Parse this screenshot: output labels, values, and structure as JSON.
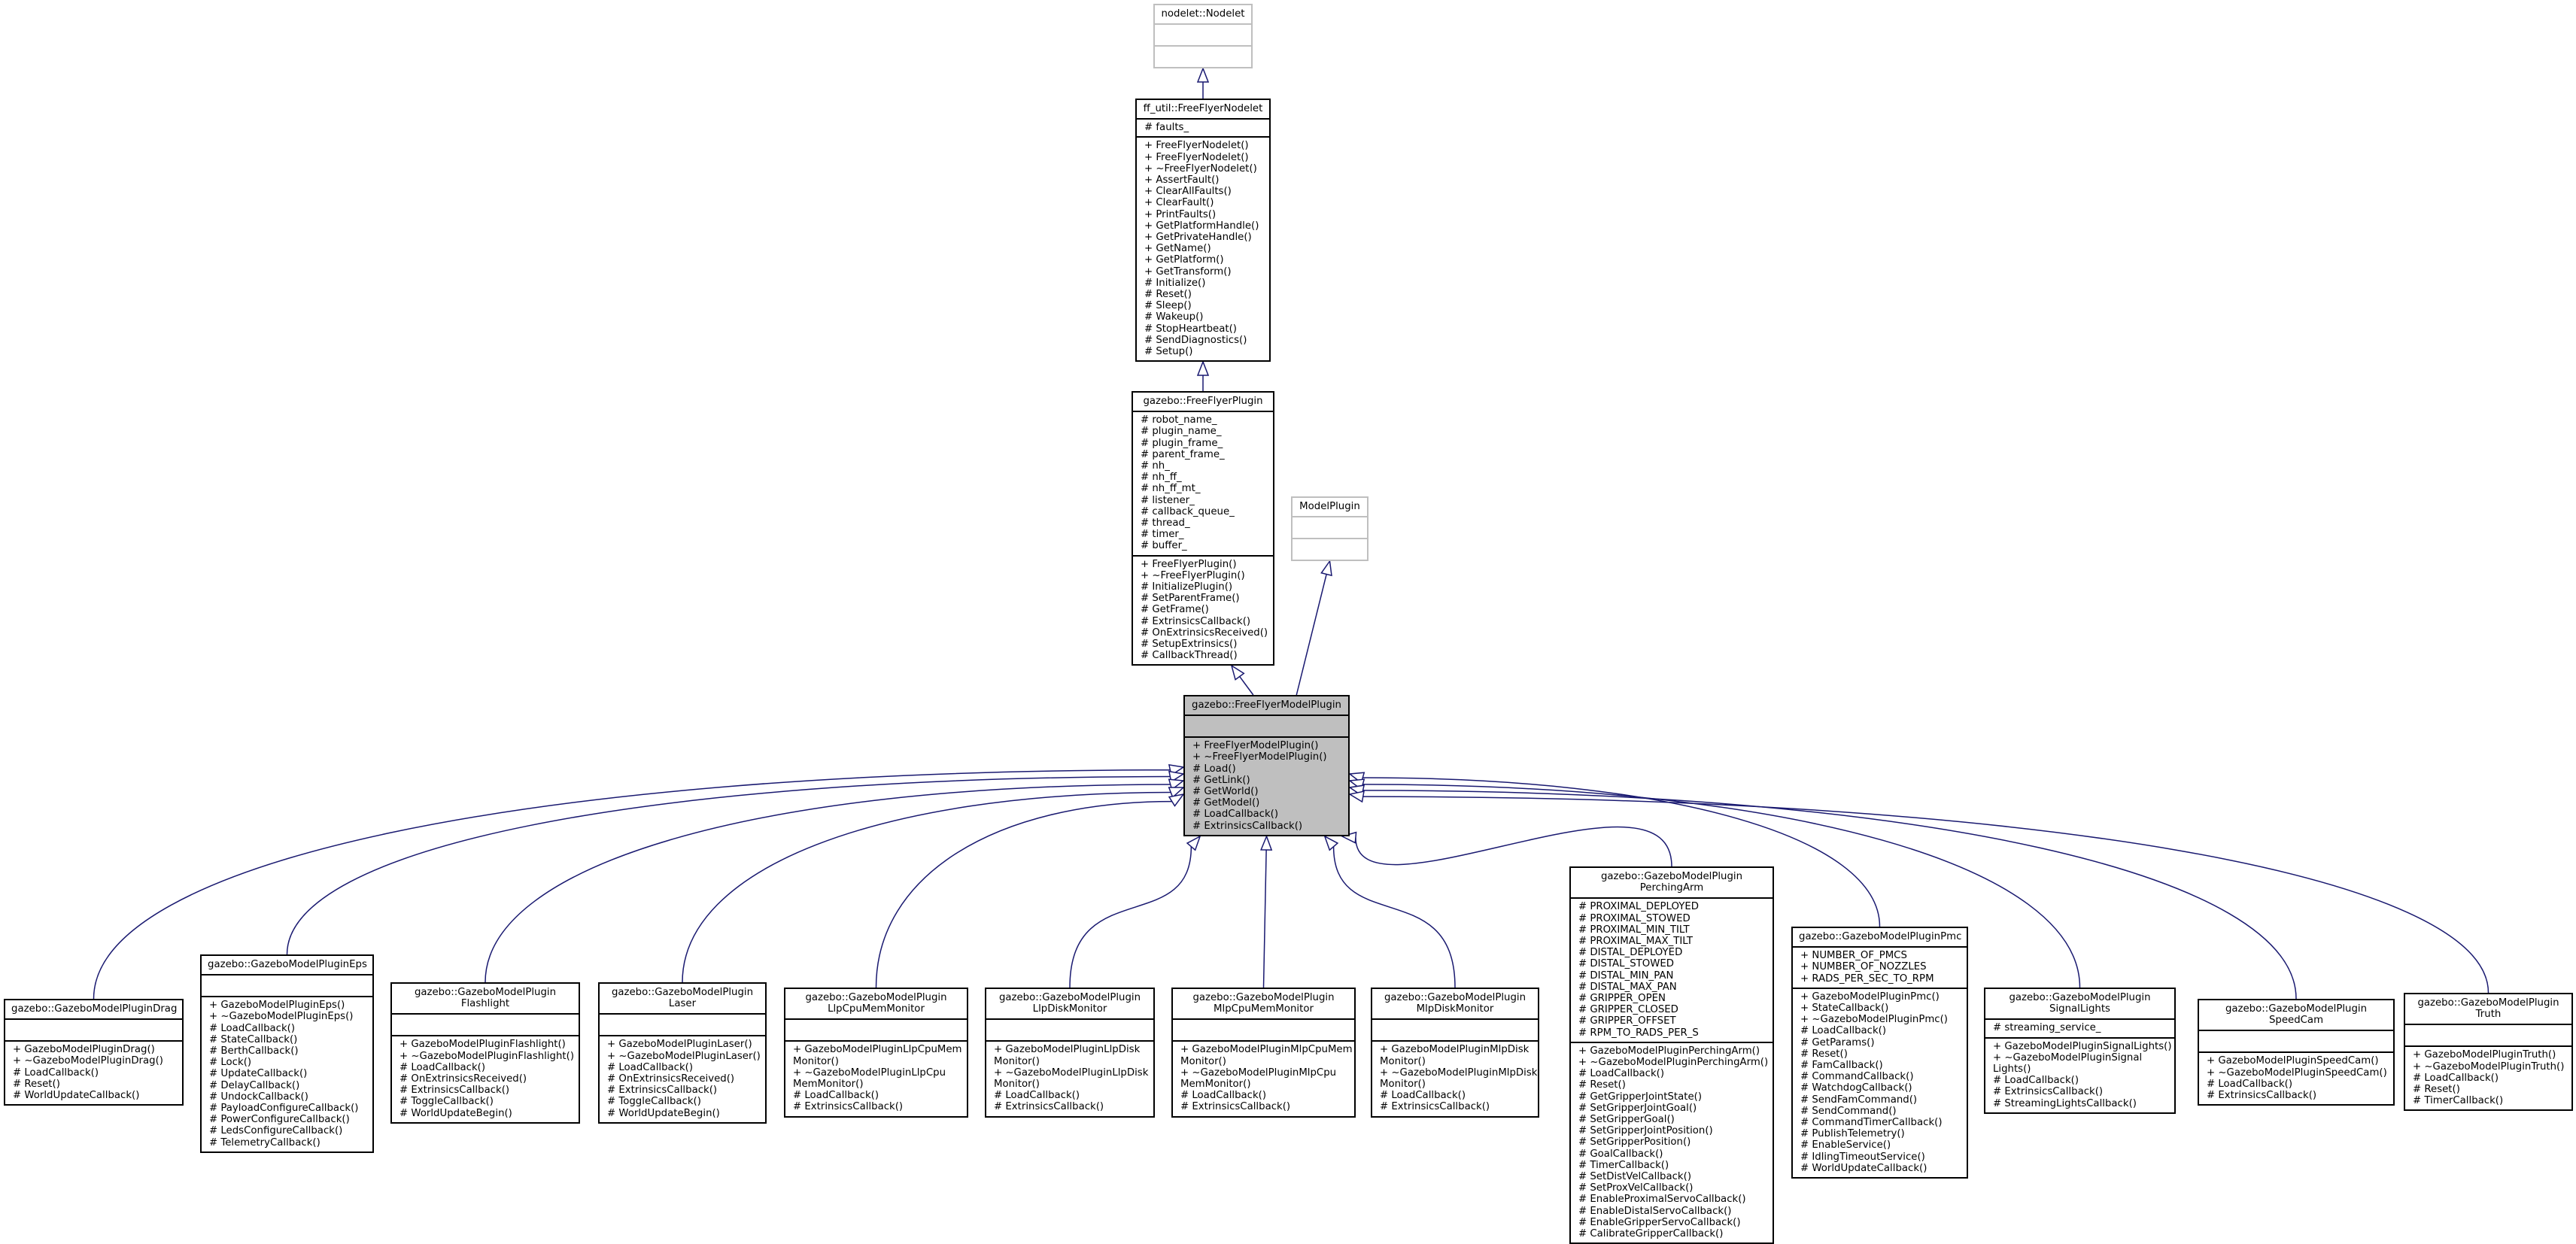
{
  "diagram": {
    "type": "inheritance-graph",
    "edge_color": "#191970",
    "focus_fill": "#bfbfbf",
    "classes": [
      {
        "id": "nodelet",
        "name": "nodelet::Nodelet",
        "external": true,
        "attributes": [],
        "methods": []
      },
      {
        "id": "ffnodelet",
        "name": "ff_util::FreeFlyerNodelet",
        "attributes": [
          "# faults_"
        ],
        "methods": [
          "+ FreeFlyerNodelet()",
          "+ FreeFlyerNodelet()",
          "+ ~FreeFlyerNodelet()",
          "+ AssertFault()",
          "+ ClearAllFaults()",
          "+ ClearFault()",
          "+ PrintFaults()",
          "+ GetPlatformHandle()",
          "+ GetPrivateHandle()",
          "+ GetName()",
          "+ GetPlatform()",
          "+ GetTransform()",
          "# Initialize()",
          "# Reset()",
          "# Sleep()",
          "# Wakeup()",
          "# StopHeartbeat()",
          "# SendDiagnostics()",
          "# Setup()"
        ]
      },
      {
        "id": "ffplugin",
        "name": "gazebo::FreeFlyerPlugin",
        "attributes": [
          "# robot_name_",
          "# plugin_name_",
          "# plugin_frame_",
          "# parent_frame_",
          "# nh_",
          "# nh_ff_",
          "# nh_ff_mt_",
          "# listener_",
          "# callback_queue_",
          "# thread_",
          "# timer_",
          "# buffer_"
        ],
        "methods": [
          "+ FreeFlyerPlugin()",
          "+ ~FreeFlyerPlugin()",
          "# InitializePlugin()",
          "# SetParentFrame()",
          "# GetFrame()",
          "# ExtrinsicsCallback()",
          "# OnExtrinsicsReceived()",
          "# SetupExtrinsics()",
          "# CallbackThread()"
        ]
      },
      {
        "id": "modelplugin",
        "name": "ModelPlugin",
        "external": true,
        "attributes": [],
        "methods": []
      },
      {
        "id": "ffmodel",
        "name": "gazebo::FreeFlyerModelPlugin",
        "focus": true,
        "attributes": [],
        "methods": [
          "+ FreeFlyerModelPlugin()",
          "+ ~FreeFlyerModelPlugin()",
          "# Load()",
          "# GetLink()",
          "# GetWorld()",
          "# GetModel()",
          "# LoadCallback()",
          "# ExtrinsicsCallback()"
        ]
      },
      {
        "id": "drag",
        "name": "gazebo::GazeboModelPluginDrag",
        "attributes": [],
        "methods": [
          "+ GazeboModelPluginDrag()",
          "+ ~GazeboModelPluginDrag()",
          "# LoadCallback()",
          "# Reset()",
          "# WorldUpdateCallback()"
        ]
      },
      {
        "id": "eps",
        "name": "gazebo::GazeboModelPluginEps",
        "attributes": [],
        "methods": [
          "+ GazeboModelPluginEps()",
          "+ ~GazeboModelPluginEps()",
          "# LoadCallback()",
          "# StateCallback()",
          "# BerthCallback()",
          "# Lock()",
          "# UpdateCallback()",
          "# DelayCallback()",
          "# UndockCallback()",
          "# PayloadConfigureCallback()",
          "# PowerConfigureCallback()",
          "# LedsConfigureCallback()",
          "# TelemetryCallback()"
        ]
      },
      {
        "id": "flashlight",
        "name": "gazebo::GazeboModelPlugin\nFlashlight",
        "attributes": [],
        "methods": [
          "+ GazeboModelPluginFlashlight()",
          "+ ~GazeboModelPluginFlashlight()",
          "# LoadCallback()",
          "# OnExtrinsicsReceived()",
          "# ExtrinsicsCallback()",
          "# ToggleCallback()",
          "# WorldUpdateBegin()"
        ]
      },
      {
        "id": "laser",
        "name": "gazebo::GazeboModelPlugin\nLaser",
        "attributes": [],
        "methods": [
          "+ GazeboModelPluginLaser()",
          "+ ~GazeboModelPluginLaser()",
          "# LoadCallback()",
          "# OnExtrinsicsReceived()",
          "# ExtrinsicsCallback()",
          "# ToggleCallback()",
          "# WorldUpdateBegin()"
        ]
      },
      {
        "id": "llpcpu",
        "name": "gazebo::GazeboModelPlugin\nLlpCpuMemMonitor",
        "attributes": [],
        "methods": [
          "+ GazeboModelPluginLlpCpuMem",
          "Monitor()",
          "+ ~GazeboModelPluginLlpCpu",
          "MemMonitor()",
          "# LoadCallback()",
          "# ExtrinsicsCallback()"
        ]
      },
      {
        "id": "llpdisk",
        "name": "gazebo::GazeboModelPlugin\nLlpDiskMonitor",
        "attributes": [],
        "methods": [
          "+ GazeboModelPluginLlpDisk",
          "Monitor()",
          "+ ~GazeboModelPluginLlpDisk",
          "Monitor()",
          "# LoadCallback()",
          "# ExtrinsicsCallback()"
        ]
      },
      {
        "id": "mlpcpu",
        "name": "gazebo::GazeboModelPlugin\nMlpCpuMemMonitor",
        "attributes": [],
        "methods": [
          "+ GazeboModelPluginMlpCpuMem",
          "Monitor()",
          "+ ~GazeboModelPluginMlpCpu",
          "MemMonitor()",
          "# LoadCallback()",
          "# ExtrinsicsCallback()"
        ]
      },
      {
        "id": "mlpdisk",
        "name": "gazebo::GazeboModelPlugin\nMlpDiskMonitor",
        "attributes": [],
        "methods": [
          "+ GazeboModelPluginMlpDisk",
          "Monitor()",
          "+ ~GazeboModelPluginMlpDisk",
          "Monitor()",
          "# LoadCallback()",
          "# ExtrinsicsCallback()"
        ]
      },
      {
        "id": "perching",
        "name": "gazebo::GazeboModelPlugin\nPerchingArm",
        "attributes": [
          "# PROXIMAL_DEPLOYED",
          "# PROXIMAL_STOWED",
          "# PROXIMAL_MIN_TILT",
          "# PROXIMAL_MAX_TILT",
          "# DISTAL_DEPLOYED",
          "# DISTAL_STOWED",
          "# DISTAL_MIN_PAN",
          "# DISTAL_MAX_PAN",
          "# GRIPPER_OPEN",
          "# GRIPPER_CLOSED",
          "# GRIPPER_OFFSET",
          "# RPM_TO_RADS_PER_S"
        ],
        "methods": [
          "+ GazeboModelPluginPerchingArm()",
          "+ ~GazeboModelPluginPerchingArm()",
          "# LoadCallback()",
          "# Reset()",
          "# GetGripperJointState()",
          "# SetGripperJointGoal()",
          "# SetGripperGoal()",
          "# SetGripperJointPosition()",
          "# SetGripperPosition()",
          "# GoalCallback()",
          "# TimerCallback()",
          "# SetDistVelCallback()",
          "# SetProxVelCallback()",
          "# EnableProximalServoCallback()",
          "# EnableDistalServoCallback()",
          "# EnableGripperServoCallback()",
          "# CalibrateGripperCallback()"
        ]
      },
      {
        "id": "pmc",
        "name": "gazebo::GazeboModelPluginPmc",
        "attributes": [
          "+ NUMBER_OF_PMCS",
          "+ NUMBER_OF_NOZZLES",
          "+ RADS_PER_SEC_TO_RPM"
        ],
        "methods": [
          "+ GazeboModelPluginPmc()",
          "+ StateCallback()",
          "+ ~GazeboModelPluginPmc()",
          "# LoadCallback()",
          "# GetParams()",
          "# Reset()",
          "# FamCallback()",
          "# CommandCallback()",
          "# WatchdogCallback()",
          "# SendFamCommand()",
          "# SendCommand()",
          "# CommandTimerCallback()",
          "# PublishTelemetry()",
          "# EnableService()",
          "# IdlingTimeoutService()",
          "# WorldUpdateCallback()"
        ]
      },
      {
        "id": "signallights",
        "name": "gazebo::GazeboModelPlugin\nSignalLights",
        "attributes": [
          "# streaming_service_"
        ],
        "methods": [
          "+ GazeboModelPluginSignalLights()",
          "+ ~GazeboModelPluginSignal",
          "Lights()",
          "# LoadCallback()",
          "# ExtrinsicsCallback()",
          "# StreamingLightsCallback()"
        ]
      },
      {
        "id": "speedcam",
        "name": "gazebo::GazeboModelPlugin\nSpeedCam",
        "attributes": [],
        "methods": [
          "+ GazeboModelPluginSpeedCam()",
          "+ ~GazeboModelPluginSpeedCam()",
          "# LoadCallback()",
          "# ExtrinsicsCallback()"
        ]
      },
      {
        "id": "truth",
        "name": "gazebo::GazeboModelPlugin\nTruth",
        "attributes": [],
        "methods": [
          "+ GazeboModelPluginTruth()",
          "+ ~GazeboModelPluginTruth()",
          "# LoadCallback()",
          "# Reset()",
          "# TimerCallback()"
        ]
      }
    ],
    "edges": [
      {
        "from": "ffnodelet",
        "to": "nodelet"
      },
      {
        "from": "ffplugin",
        "to": "ffnodelet"
      },
      {
        "from": "ffmodel",
        "to": "ffplugin"
      },
      {
        "from": "ffmodel",
        "to": "modelplugin"
      },
      {
        "from": "drag",
        "to": "ffmodel"
      },
      {
        "from": "eps",
        "to": "ffmodel"
      },
      {
        "from": "flashlight",
        "to": "ffmodel"
      },
      {
        "from": "laser",
        "to": "ffmodel"
      },
      {
        "from": "llpcpu",
        "to": "ffmodel"
      },
      {
        "from": "llpdisk",
        "to": "ffmodel"
      },
      {
        "from": "mlpcpu",
        "to": "ffmodel"
      },
      {
        "from": "mlpdisk",
        "to": "ffmodel"
      },
      {
        "from": "perching",
        "to": "ffmodel"
      },
      {
        "from": "pmc",
        "to": "ffmodel"
      },
      {
        "from": "signallights",
        "to": "ffmodel"
      },
      {
        "from": "speedcam",
        "to": "ffmodel"
      },
      {
        "from": "truth",
        "to": "ffmodel"
      }
    ]
  }
}
